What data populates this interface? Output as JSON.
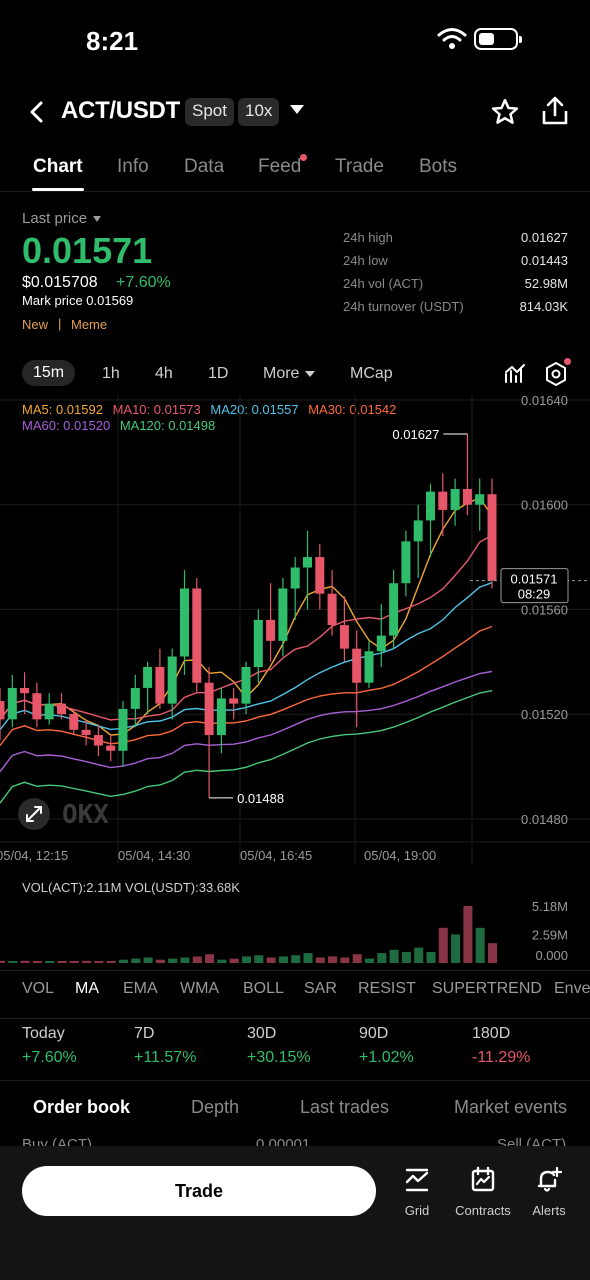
{
  "status": {
    "time": "8:21"
  },
  "header": {
    "pair": "ACT/USDT",
    "tag_spot": "Spot",
    "tag_leverage": "10x"
  },
  "tabs": [
    "Chart",
    "Info",
    "Data",
    "Feed",
    "Trade",
    "Bots"
  ],
  "price": {
    "last_label": "Last price",
    "last": "0.01571",
    "usd": "$0.015708",
    "change": "+7.60%",
    "mark": "Mark price 0.01569",
    "tag_new": "New",
    "tag_sep": "|",
    "tag_meme": "Meme"
  },
  "stats": [
    {
      "label": "24h high",
      "value": "0.01627"
    },
    {
      "label": "24h low",
      "value": "0.01443"
    },
    {
      "label": "24h vol (ACT)",
      "value": "52.98M"
    },
    {
      "label": "24h turnover (USDT)",
      "value": "814.03K"
    }
  ],
  "intervals": [
    "15m",
    "1h",
    "4h",
    "1D",
    "More",
    "MCap"
  ],
  "ma_legend": [
    {
      "text": "MA5: 0.01592",
      "color": "#f0a830"
    },
    {
      "text": "MA10: 0.01573",
      "color": "#e85a6e"
    },
    {
      "text": "MA20: 0.01557",
      "color": "#4fc3e6"
    },
    {
      "text": "MA30: 0.01542",
      "color": "#ff6a3d"
    },
    {
      "text": "MA60: 0.01520",
      "color": "#a95fd8"
    },
    {
      "text": "MA120: 0.01498",
      "color": "#47c97a"
    }
  ],
  "chart": {
    "y_ticks": [
      "0.01640",
      "0.01600",
      "0.01560",
      "0.01520",
      "0.01480"
    ],
    "x_ticks": [
      "05/04, 12:15",
      "05/04, 14:30",
      "05/04, 16:45",
      "05/04, 19:00"
    ],
    "high_label": "0.01627",
    "low_label": "0.01488",
    "current_price": "0.01571",
    "countdown": "08:29"
  },
  "chart_data": {
    "type": "candlestick",
    "interval": "15m",
    "ylim": [
      0.0147,
      0.0164
    ],
    "candles": [
      {
        "o": 0.01525,
        "h": 0.0153,
        "l": 0.0151,
        "c": 0.01518
      },
      {
        "o": 0.01518,
        "h": 0.01535,
        "l": 0.01515,
        "c": 0.0153
      },
      {
        "o": 0.0153,
        "h": 0.01536,
        "l": 0.0152,
        "c": 0.01528
      },
      {
        "o": 0.01528,
        "h": 0.01532,
        "l": 0.01515,
        "c": 0.01518
      },
      {
        "o": 0.01518,
        "h": 0.01528,
        "l": 0.01516,
        "c": 0.01524
      },
      {
        "o": 0.01524,
        "h": 0.01528,
        "l": 0.01518,
        "c": 0.0152
      },
      {
        "o": 0.0152,
        "h": 0.01522,
        "l": 0.01512,
        "c": 0.01514
      },
      {
        "o": 0.01514,
        "h": 0.01518,
        "l": 0.01508,
        "c": 0.01512
      },
      {
        "o": 0.01512,
        "h": 0.01516,
        "l": 0.01504,
        "c": 0.01508
      },
      {
        "o": 0.01508,
        "h": 0.01512,
        "l": 0.01502,
        "c": 0.01506
      },
      {
        "o": 0.01506,
        "h": 0.01525,
        "l": 0.015,
        "c": 0.01522
      },
      {
        "o": 0.01522,
        "h": 0.01535,
        "l": 0.01515,
        "c": 0.0153
      },
      {
        "o": 0.0153,
        "h": 0.0154,
        "l": 0.0152,
        "c": 0.01538
      },
      {
        "o": 0.01538,
        "h": 0.01545,
        "l": 0.01522,
        "c": 0.01524
      },
      {
        "o": 0.01524,
        "h": 0.01545,
        "l": 0.01518,
        "c": 0.01542
      },
      {
        "o": 0.01542,
        "h": 0.01575,
        "l": 0.01535,
        "c": 0.01568
      },
      {
        "o": 0.01568,
        "h": 0.01572,
        "l": 0.01528,
        "c": 0.01532
      },
      {
        "o": 0.01532,
        "h": 0.01538,
        "l": 0.01488,
        "c": 0.01512
      },
      {
        "o": 0.01512,
        "h": 0.0153,
        "l": 0.01505,
        "c": 0.01526
      },
      {
        "o": 0.01526,
        "h": 0.0153,
        "l": 0.01518,
        "c": 0.01524
      },
      {
        "o": 0.01524,
        "h": 0.0154,
        "l": 0.0152,
        "c": 0.01538
      },
      {
        "o": 0.01538,
        "h": 0.0156,
        "l": 0.01532,
        "c": 0.01556
      },
      {
        "o": 0.01556,
        "h": 0.0157,
        "l": 0.0154,
        "c": 0.01548
      },
      {
        "o": 0.01548,
        "h": 0.01572,
        "l": 0.01542,
        "c": 0.01568
      },
      {
        "o": 0.01568,
        "h": 0.0158,
        "l": 0.01556,
        "c": 0.01576
      },
      {
        "o": 0.01576,
        "h": 0.0159,
        "l": 0.0156,
        "c": 0.0158
      },
      {
        "o": 0.0158,
        "h": 0.01585,
        "l": 0.0156,
        "c": 0.01566
      },
      {
        "o": 0.01566,
        "h": 0.01575,
        "l": 0.0155,
        "c": 0.01554
      },
      {
        "o": 0.01554,
        "h": 0.01565,
        "l": 0.0154,
        "c": 0.01545
      },
      {
        "o": 0.01545,
        "h": 0.01552,
        "l": 0.01515,
        "c": 0.01532
      },
      {
        "o": 0.01532,
        "h": 0.01548,
        "l": 0.0153,
        "c": 0.01544
      },
      {
        "o": 0.01544,
        "h": 0.01562,
        "l": 0.01538,
        "c": 0.0155
      },
      {
        "o": 0.0155,
        "h": 0.01575,
        "l": 0.01545,
        "c": 0.0157
      },
      {
        "o": 0.0157,
        "h": 0.0159,
        "l": 0.01565,
        "c": 0.01586
      },
      {
        "o": 0.01586,
        "h": 0.016,
        "l": 0.01572,
        "c": 0.01594
      },
      {
        "o": 0.01594,
        "h": 0.01608,
        "l": 0.0158,
        "c": 0.01605
      },
      {
        "o": 0.01605,
        "h": 0.01612,
        "l": 0.01588,
        "c": 0.01598
      },
      {
        "o": 0.01598,
        "h": 0.0161,
        "l": 0.01592,
        "c": 0.01606
      },
      {
        "o": 0.01606,
        "h": 0.01627,
        "l": 0.01596,
        "c": 0.016
      },
      {
        "o": 0.016,
        "h": 0.0161,
        "l": 0.0159,
        "c": 0.01604
      },
      {
        "o": 0.01604,
        "h": 0.0161,
        "l": 0.01568,
        "c": 0.01571
      }
    ],
    "volume": {
      "ylim": [
        0,
        5.18
      ],
      "ticks": [
        "5.18M",
        "2.59M",
        "0.000"
      ],
      "values": [
        0.2,
        0.15,
        0.2,
        0.1,
        0.15,
        0.1,
        0.15,
        0.2,
        0.1,
        0.15,
        0.3,
        0.4,
        0.5,
        0.3,
        0.4,
        0.5,
        0.6,
        0.8,
        0.3,
        0.4,
        0.6,
        0.7,
        0.5,
        0.6,
        0.7,
        0.9,
        0.5,
        0.6,
        0.5,
        0.8,
        0.4,
        0.9,
        1.2,
        1.0,
        1.4,
        1.0,
        3.2,
        2.6,
        5.18,
        3.2,
        1.8
      ]
    }
  },
  "volume_label": "VOL(ACT):2.11M  VOL(USDT):33.68K",
  "indicators": [
    "VOL",
    "MA",
    "EMA",
    "WMA",
    "BOLL",
    "SAR",
    "RESIST",
    "SUPERTREND",
    "Enve"
  ],
  "performance": [
    {
      "label": "Today",
      "value": "+7.60%",
      "color": "#2fbd6b"
    },
    {
      "label": "7D",
      "value": "+11.57%",
      "color": "#2fbd6b"
    },
    {
      "label": "30D",
      "value": "+30.15%",
      "color": "#2fbd6b"
    },
    {
      "label": "90D",
      "value": "+1.02%",
      "color": "#2fbd6b"
    },
    {
      "label": "180D",
      "value": "-11.29%",
      "color": "#e8566a"
    }
  ],
  "orderbook_tabs": [
    "Order book",
    "Depth",
    "Last trades",
    "Market events"
  ],
  "orderbook_head": {
    "buy": "Buy (ACT)",
    "step": "0.00001",
    "sell": "Sell (ACT)"
  },
  "bottom": {
    "trade": "Trade",
    "grid": "Grid",
    "contracts": "Contracts",
    "alerts": "Alerts"
  }
}
